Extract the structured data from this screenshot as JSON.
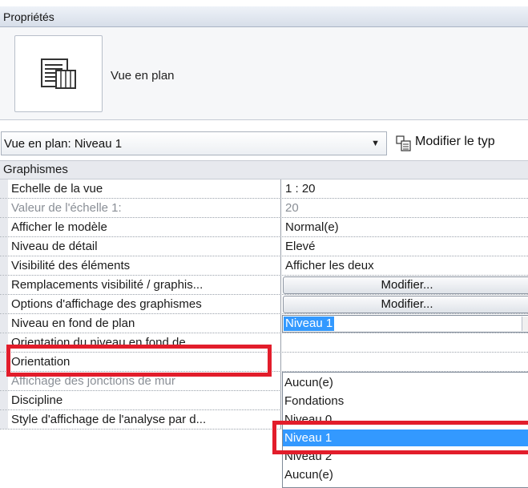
{
  "panel": {
    "title": "Propriétés"
  },
  "type_preview": {
    "name": "Vue en plan",
    "icon": "floor-plan-view-icon"
  },
  "type_selector": {
    "value": "Vue en plan: Niveau 1",
    "edit_type_label": "Modifier le typ"
  },
  "group": {
    "label": "Graphismes"
  },
  "rows": [
    {
      "name": "Echelle de la vue",
      "value": "1 : 20"
    },
    {
      "name": "Valeur de l'échelle    1:",
      "value": "20",
      "disabled": true
    },
    {
      "name": "Afficher le modèle",
      "value": "Normal(e)"
    },
    {
      "name": "Niveau de détail",
      "value": "Elevé"
    },
    {
      "name": "Visibilité des éléments",
      "value": "Afficher les deux"
    },
    {
      "name": "Remplacements visibilité / graphis...",
      "button": "Modifier..."
    },
    {
      "name": "Options d'affichage des graphismes",
      "button": "Modifier..."
    },
    {
      "name": "Niveau en fond de plan",
      "value": "Niveau 1"
    },
    {
      "name": "Orientation du niveau en fond de ..."
    },
    {
      "name": "Orientation"
    },
    {
      "name": "Affichage des jonctions de mur",
      "disabled": true
    },
    {
      "name": "Discipline"
    },
    {
      "name": "Style d'affichage de l'analyse par d..."
    }
  ],
  "dropdown": {
    "items": [
      "Aucun(e)",
      "Fondations",
      "Niveau 0",
      "Niveau 1",
      "Niveau 2",
      "Aucun(e)"
    ],
    "selected": "Niveau 1"
  },
  "colors": {
    "highlight": "#e21d2b",
    "selection": "#3399ff"
  }
}
